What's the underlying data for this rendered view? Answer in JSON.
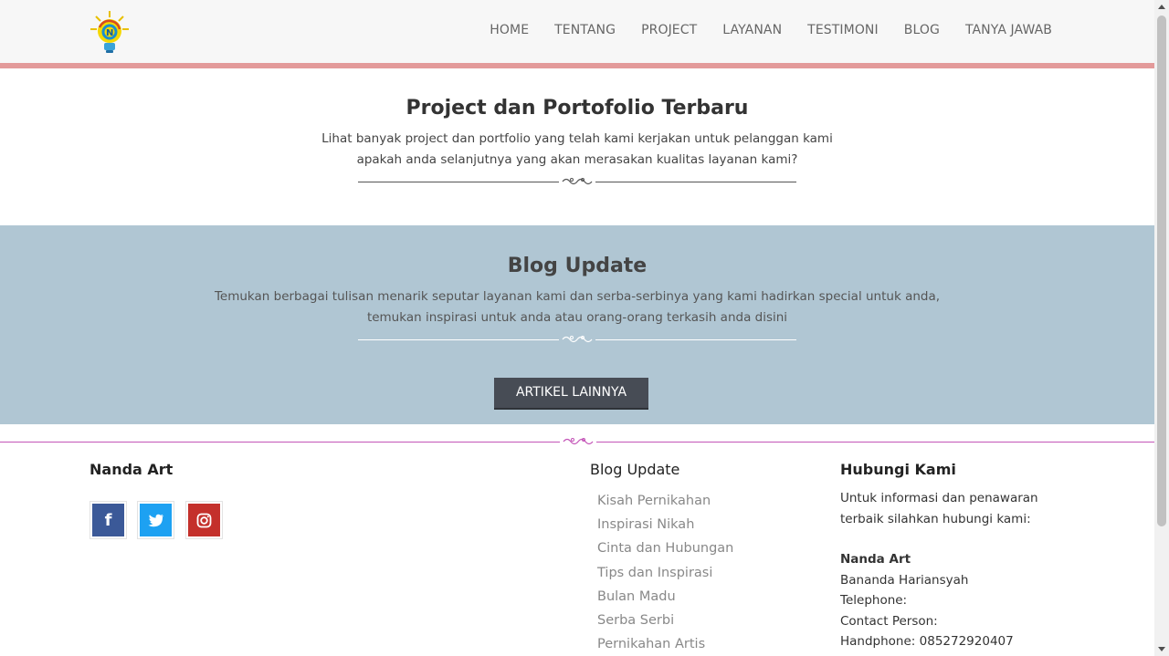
{
  "header": {
    "logo_icon": "lightbulb-logo-icon",
    "nav": [
      "HOME",
      "TENTANG",
      "PROJECT",
      "LAYANAN",
      "TESTIMONI",
      "BLOG",
      "TANYA JAWAB"
    ]
  },
  "project": {
    "title": "Project dan Portofolio Terbaru",
    "subtitle_line1": "Lihat banyak project dan portfolio yang telah kami kerjakan untuk pelanggan kami",
    "subtitle_line2": "apakah anda selanjutnya yang akan merasakan kualitas layanan kami?"
  },
  "blog": {
    "title": "Blog Update",
    "subtitle_line1": "Temukan berbagai tulisan menarik seputar layanan kami dan serba-serbinya yang kami hadirkan special untuk anda,",
    "subtitle_line2": "temukan inspirasi untuk anda atau orang-orang terkasih anda disini",
    "button_label": "ARTIKEL LAINNYA"
  },
  "footer": {
    "brand": "Nanda Art",
    "social": [
      {
        "name": "facebook-icon",
        "glyph": "f",
        "color": "#3b5998"
      },
      {
        "name": "twitter-icon",
        "glyph": "t",
        "color": "#1da1f2"
      },
      {
        "name": "instagram-icon",
        "glyph": "◎",
        "color": "#c4302b"
      }
    ],
    "blog_heading": "Blog Update",
    "blog_links": [
      "Kisah Pernikahan",
      "Inspirasi Nikah",
      "Cinta dan Hubungan",
      "Tips dan Inspirasi",
      "Bulan Madu",
      "Serba Serbi",
      "Pernikahan Artis"
    ],
    "contact_heading": "Hubungi Kami",
    "contact_intro_line1": "Untuk informasi dan penawaran",
    "contact_intro_line2": "terbaik silahkan hubungi kami:",
    "contact_name": "Nanda Art",
    "contact_person_name": "Bananda Hariansyah",
    "telephone": "Telephone:",
    "contact_person": "Contact Person:",
    "handphone": "Handphone: 085272920407"
  },
  "colors": {
    "accent_bar": "#e39a9a",
    "blog_bg": "#b0c6d3",
    "button_bg": "#474c55",
    "footer_line": "#c455b8"
  }
}
